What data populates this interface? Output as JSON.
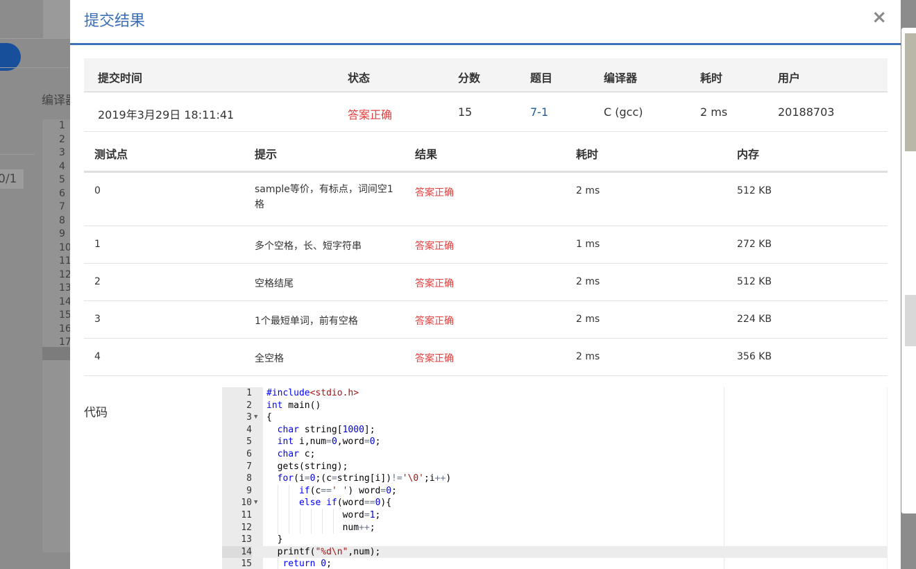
{
  "background": {
    "label": "编译器",
    "badge": "0/1",
    "line_numbers": [
      "1",
      "2",
      "3",
      "4",
      "5",
      "6",
      "7",
      "8",
      "9",
      "10",
      "11",
      "12",
      "13",
      "14",
      "15",
      "16",
      "17"
    ]
  },
  "modal": {
    "title": "提交结果",
    "close_label": "×",
    "summary": {
      "headers": [
        "提交时间",
        "状态",
        "分数",
        "题目",
        "编译器",
        "耗时",
        "用户"
      ],
      "row": {
        "time": "2019年3月29日 18:11:41",
        "status": "答案正确",
        "score": "15",
        "problem": "7-1",
        "compiler": "C (gcc)",
        "duration": "2 ms",
        "user": "20188703"
      }
    },
    "cases": {
      "headers": [
        "测试点",
        "提示",
        "结果",
        "耗时",
        "内存"
      ],
      "rows": [
        {
          "id": "0",
          "hint": "sample等价，有标点，词间空1格",
          "result": "答案正确",
          "time": "2 ms",
          "memory": "512 KB"
        },
        {
          "id": "1",
          "hint": "多个空格，长、短字符串",
          "result": "答案正确",
          "time": "1 ms",
          "memory": "272 KB"
        },
        {
          "id": "2",
          "hint": "空格结尾",
          "result": "答案正确",
          "time": "2 ms",
          "memory": "512 KB"
        },
        {
          "id": "3",
          "hint": "1个最短单词，前有空格",
          "result": "答案正确",
          "time": "2 ms",
          "memory": "224 KB"
        },
        {
          "id": "4",
          "hint": "全空格",
          "result": "答案正确",
          "time": "2 ms",
          "memory": "356 KB"
        }
      ]
    },
    "code_label": "代码",
    "code": {
      "line_numbers": [
        "1",
        "2",
        "3",
        "4",
        "5",
        "6",
        "7",
        "8",
        "9",
        "10",
        "11",
        "12",
        "13",
        "14",
        "15"
      ],
      "folded_lines": [
        "3",
        "10"
      ],
      "active_line": "14",
      "lines": [
        "#include<stdio.h>",
        "int main()",
        "{",
        "  char string[1000];",
        "  int i,num=0,word=0;",
        "  char c;",
        "  gets(string);",
        "  for(i=0;(c=string[i])!='\\0';i++)",
        "      if(c==' ') word=0;",
        "      else if(word==0){",
        "              word=1;",
        "              num++;",
        "  }",
        "  printf(\"%d\\n\",num);",
        "   return 0;"
      ]
    }
  }
}
